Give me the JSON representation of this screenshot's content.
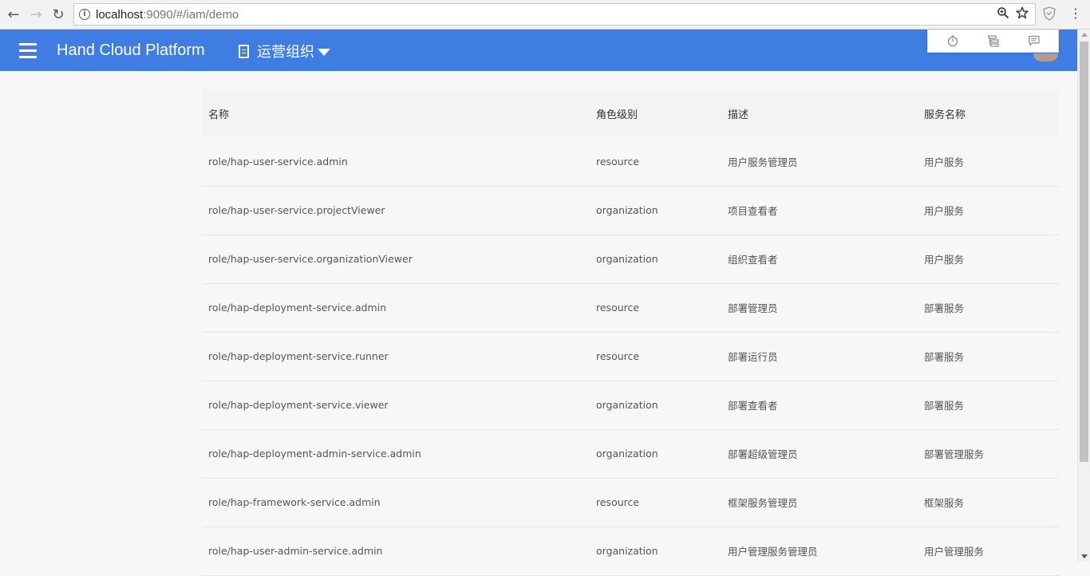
{
  "browser": {
    "back_icon": "←",
    "forward_icon": "→",
    "reload_icon": "↻",
    "url_host": "localhost",
    "url_path": ":9090/#/iam/demo",
    "menu_icon": "⋮"
  },
  "header": {
    "app_title": "Hand Cloud Platform",
    "org_name": "运营组织",
    "accent_color": "#3f7de3"
  },
  "table": {
    "columns": [
      "名称",
      "角色级别",
      "描述",
      "服务名称"
    ],
    "rows": [
      [
        "role/hap-user-service.admin",
        "resource",
        "用户服务管理员",
        "用户服务"
      ],
      [
        "role/hap-user-service.projectViewer",
        "organization",
        "项目查看者",
        "用户服务"
      ],
      [
        "role/hap-user-service.organizationViewer",
        "organization",
        "组织查看者",
        "用户服务"
      ],
      [
        "role/hap-deployment-service.admin",
        "resource",
        "部署管理员",
        "部署服务"
      ],
      [
        "role/hap-deployment-service.runner",
        "resource",
        "部署运行员",
        "部署服务"
      ],
      [
        "role/hap-deployment-service.viewer",
        "organization",
        "部署查看者",
        "部署服务"
      ],
      [
        "role/hap-deployment-admin-service.admin",
        "organization",
        "部署超级管理员",
        "部署管理服务"
      ],
      [
        "role/hap-framework-service.admin",
        "resource",
        "框架服务管理员",
        "框架服务"
      ],
      [
        "role/hap-user-admin-service.admin",
        "organization",
        "用户管理服务管理员",
        "用户管理服务"
      ]
    ]
  }
}
